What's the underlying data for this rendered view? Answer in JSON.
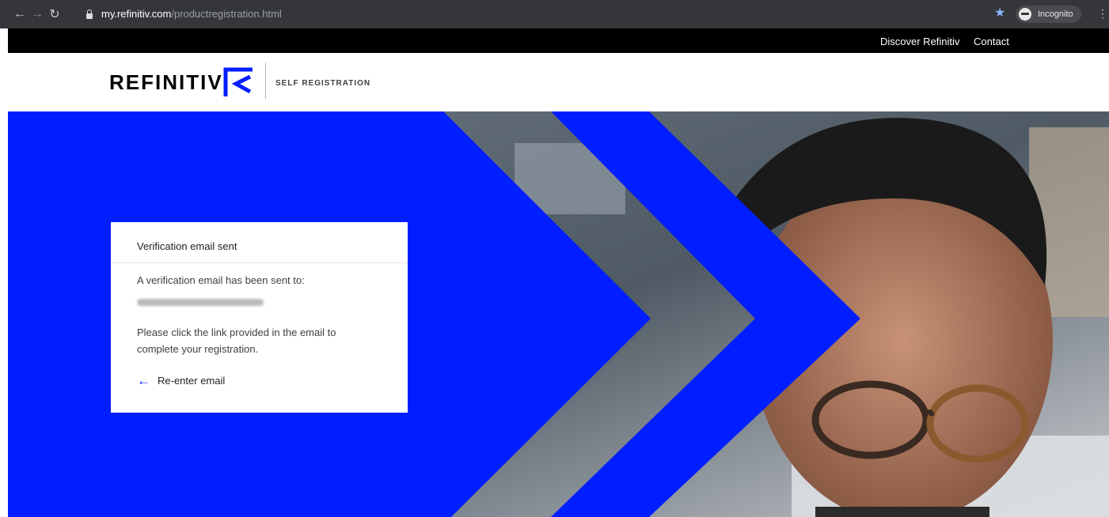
{
  "browser": {
    "url_host": "my.refinitiv.com",
    "url_path": "/productregistration.html",
    "profile_label": "Incognito"
  },
  "topnav": {
    "discover": "Discover Refinitiv",
    "contact": "Contact"
  },
  "header": {
    "logo_text": "REFINITIV",
    "product": "SELF REGISTRATION"
  },
  "card": {
    "title": "Verification email sent",
    "sent_to_text": "A verification email has been sent to:",
    "instructions": "Please click the link provided in the email to complete your registration.",
    "reenter_label": "Re-enter email"
  },
  "colors": {
    "brand_blue": "#001eff",
    "topbar": "#000000",
    "chrome": "#35363a"
  },
  "icons": [
    "back-arrow-icon",
    "forward-arrow-icon",
    "reload-icon",
    "lock-icon",
    "star-icon",
    "incognito-icon",
    "menu-kebab-icon",
    "refinitiv-logo-icon",
    "arrow-left-icon"
  ]
}
